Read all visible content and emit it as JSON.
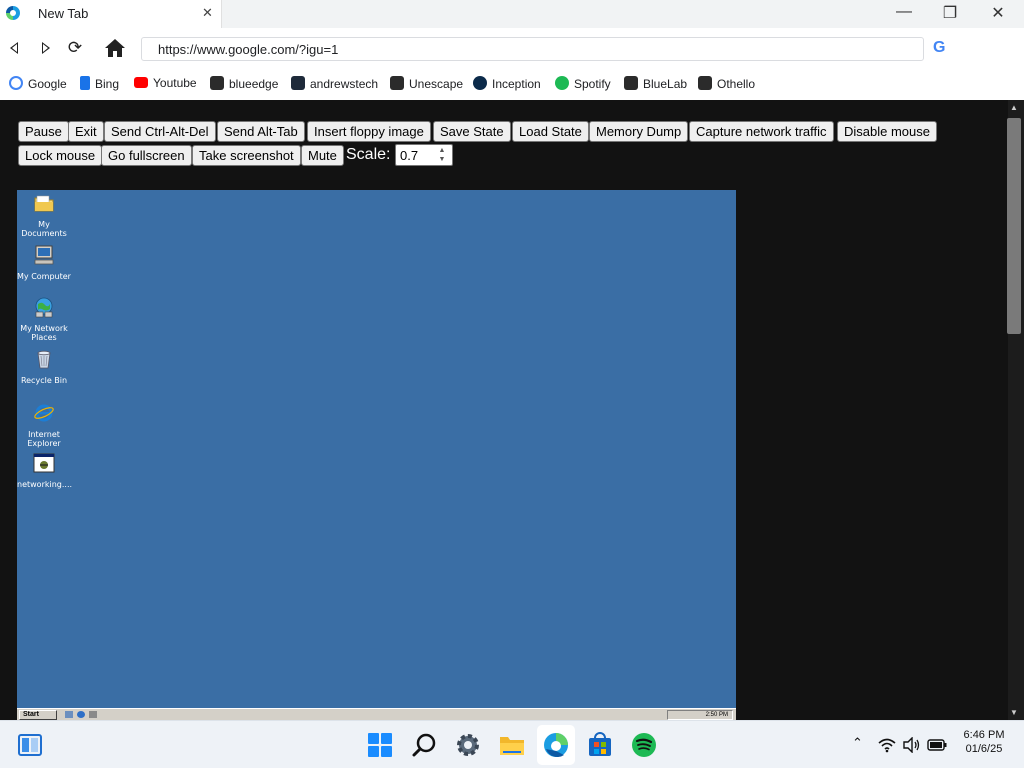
{
  "browser": {
    "tab_title": "New Tab",
    "tab_close": "✕",
    "window_controls": {
      "minimize": "—",
      "restore": "❐",
      "close": "✕"
    },
    "url": "https://www.google.com/?igu=1",
    "search_engine_letter": "G",
    "bookmarks": [
      {
        "label": "Google",
        "icon": "google-icon",
        "color": "#4285f4"
      },
      {
        "label": "Bing",
        "icon": "bing-icon",
        "color": "#1a73e8"
      },
      {
        "label": "Youtube",
        "icon": "youtube-icon",
        "color": "#ff0000"
      },
      {
        "label": "blueedge",
        "icon": "react-icon",
        "color": "#2b2b2b"
      },
      {
        "label": "andrewstech",
        "icon": "site-icon",
        "color": "#1e2a3a"
      },
      {
        "label": "Unescape",
        "icon": "react-icon",
        "color": "#2b2b2b"
      },
      {
        "label": "Inception",
        "icon": "inception-icon",
        "color": "#0b2a4a"
      },
      {
        "label": "Spotify",
        "icon": "spotify-icon",
        "color": "#1db954"
      },
      {
        "label": "BlueLab",
        "icon": "react-icon",
        "color": "#2b2b2b"
      },
      {
        "label": "Othello",
        "icon": "react-icon",
        "color": "#2b2b2b"
      }
    ]
  },
  "emulator": {
    "buttons_row1": [
      "Pause",
      "Exit",
      "Send Ctrl-Alt-Del",
      "Send Alt-Tab",
      "Insert floppy image",
      "Save State",
      "Load State",
      "Memory Dump",
      "Capture network traffic",
      "Disable mouse"
    ],
    "buttons_row2": [
      "Lock mouse",
      "Go fullscreen",
      "Take screenshot",
      "Mute"
    ],
    "scale_label": "Scale:",
    "scale_value": "0.7",
    "desktop_color": "#3a6ea5",
    "desktop_icons": [
      {
        "label": "My Documents",
        "icon": "folder-icon"
      },
      {
        "label": "My Computer",
        "icon": "computer-icon"
      },
      {
        "label": "My Network Places",
        "icon": "network-icon"
      },
      {
        "label": "Recycle Bin",
        "icon": "recycle-bin-icon"
      },
      {
        "label": "Internet Explorer",
        "icon": "ie-icon"
      },
      {
        "label": "networking....",
        "icon": "program-icon"
      }
    ],
    "start_label": "Start",
    "tray_time": "2:50 PM"
  },
  "taskbar": {
    "time": "6:46 PM",
    "date": "01/6/25",
    "pinned": [
      "widgets-icon",
      "start-icon",
      "search-icon",
      "settings-icon",
      "file-explorer-icon",
      "edge-icon",
      "store-icon",
      "spotify-icon"
    ],
    "tray": [
      "chevron-up-icon",
      "wifi-icon",
      "volume-icon",
      "battery-icon"
    ]
  }
}
